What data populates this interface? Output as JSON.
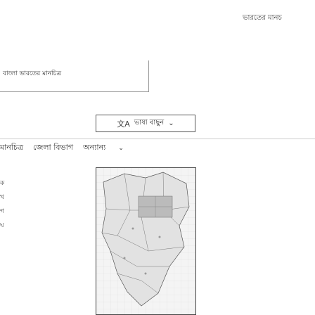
{
  "header": {
    "top_link": "ভারতের মানচ"
  },
  "title_panel": {
    "title": "বাংলা ভারতের মানচিত্র"
  },
  "language_selector": {
    "icon": "translate-icon",
    "label": "ভাষা বাছুন"
  },
  "tabs": {
    "items": [
      {
        "label": "মানচিত্র"
      },
      {
        "label": "জেলা বিভাগ"
      },
      {
        "label": "অন্যান্য"
      }
    ]
  },
  "side_nav": {
    "items": [
      {
        "label": "ক"
      },
      {
        "label": "খ"
      },
      {
        "label": "গ"
      },
      {
        "label": "ঘ"
      }
    ]
  },
  "map": {
    "icon": "map-icon"
  }
}
